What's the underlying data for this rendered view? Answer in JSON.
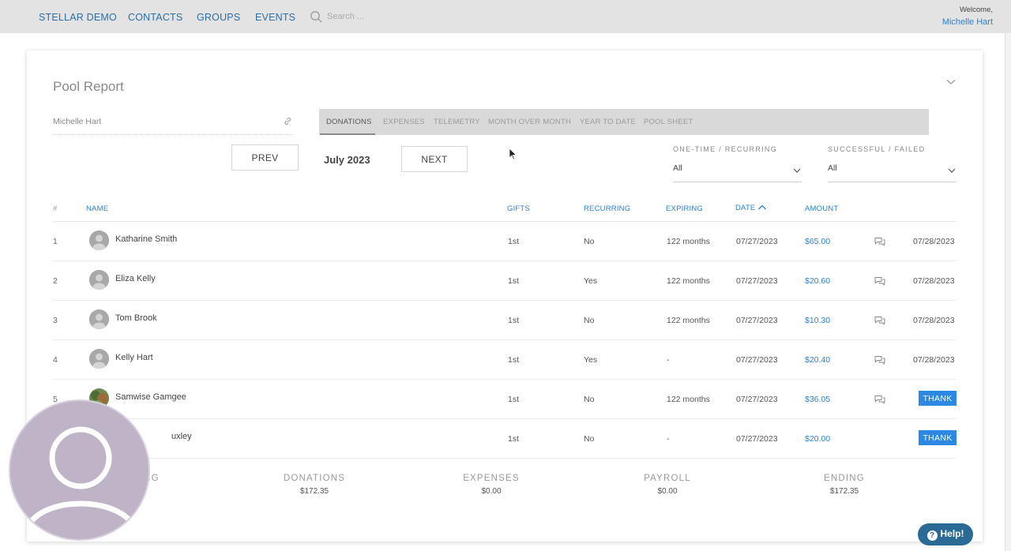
{
  "nav": {
    "items": [
      "STELLAR DEMO",
      "CONTACTS",
      "GROUPS",
      "EVENTS"
    ],
    "search_placeholder": "Search ...",
    "welcome_label": "Welcome,",
    "user_name": "Michelle Hart"
  },
  "report": {
    "title": "Pool Report",
    "owner": "Michelle Hart",
    "tabs": [
      "DONATIONS",
      "EXPENSES",
      "TELEMETRY",
      "MONTH OVER MONTH",
      "YEAR TO DATE",
      "POOL SHEET"
    ],
    "active_tab": "DONATIONS",
    "prev_label": "PREV",
    "month": "July 2023",
    "next_label": "NEXT",
    "filters": [
      {
        "label": "ONE-TIME / RECURRING",
        "value": "All"
      },
      {
        "label": "SUCCESSFUL / FAILED",
        "value": "All"
      }
    ]
  },
  "table": {
    "headers": {
      "num": "#",
      "name": "NAME",
      "gifts": "GIFTS",
      "recurring": "RECURRING",
      "expiring": "EXPIRING",
      "date": "DATE",
      "amount": "AMOUNT"
    },
    "rows": [
      {
        "num": "1",
        "name": "Katharine Smith",
        "gifts": "1st",
        "recurring": "No",
        "expiring": "122 months",
        "date": "07/27/2023",
        "amount": "$65.00",
        "thanked": "07/28/2023"
      },
      {
        "num": "2",
        "name": "Eliza Kelly",
        "gifts": "1st",
        "recurring": "Yes",
        "expiring": "122 months",
        "date": "07/27/2023",
        "amount": "$20.60",
        "thanked": "07/28/2023"
      },
      {
        "num": "3",
        "name": "Tom Brook",
        "gifts": "1st",
        "recurring": "No",
        "expiring": "122 months",
        "date": "07/27/2023",
        "amount": "$10.30",
        "thanked": "07/28/2023"
      },
      {
        "num": "4",
        "name": "Kelly Hart",
        "gifts": "1st",
        "recurring": "Yes",
        "expiring": "-",
        "date": "07/27/2023",
        "amount": "$20.40",
        "thanked": "07/28/2023"
      },
      {
        "num": "5",
        "name": "Samwise Gamgee",
        "gifts": "1st",
        "recurring": "No",
        "expiring": "122 months",
        "date": "07/27/2023",
        "amount": "$36.05",
        "thank_label": "THANK"
      },
      {
        "num": "6",
        "name": "uxley",
        "gifts": "1st",
        "recurring": "No",
        "expiring": "-",
        "date": "07/27/2023",
        "amount": "$20.00",
        "thank_label": "THANK"
      }
    ]
  },
  "summary": [
    {
      "label": "NG",
      "value": ""
    },
    {
      "label": "DONATIONS",
      "value": "$172.35"
    },
    {
      "label": "EXPENSES",
      "value": "$0.00"
    },
    {
      "label": "PAYROLL",
      "value": "$0.00"
    },
    {
      "label": "ENDING",
      "value": "$172.35"
    }
  ],
  "help_label": "Help!",
  "colors": {
    "link": "#2c80d3",
    "thank_button": "#2c88e3",
    "help_button": "#2a6b95",
    "topbar": "#e3e3e3",
    "presenter": "#bfb3c8"
  }
}
